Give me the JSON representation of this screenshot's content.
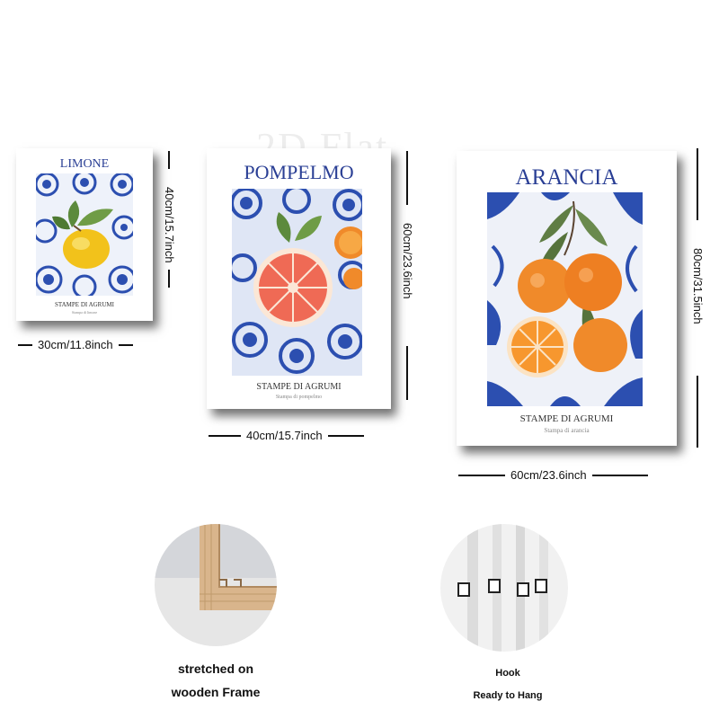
{
  "watermark": "2D Flat",
  "posters": [
    {
      "title": "LIMONE",
      "subtitle": "STAMPE DI AGRUMI",
      "fine_print": "Stampa di limone",
      "width_label": "30cm/11.8inch",
      "height_label": "40cm/15.7inch"
    },
    {
      "title": "POMPELMO",
      "subtitle": "STAMPE DI AGRUMI",
      "fine_print": "Stampa di pompelmo",
      "width_label": "40cm/15.7inch",
      "height_label": "60cm/23.6inch"
    },
    {
      "title": "ARANCIA",
      "subtitle": "STAMPE DI AGRUMI",
      "fine_print": "Stampa di arancia",
      "width_label": "60cm/23.6inch",
      "height_label": "80cm/31.5inch"
    }
  ],
  "features": [
    {
      "caption_line1": "stretched on",
      "caption_line2": "wooden Frame"
    },
    {
      "caption_line1": "Hook",
      "caption_line2": "Ready to Hang"
    }
  ],
  "colors": {
    "title_blue": "#2a3f95",
    "tile_blue": "#2c4fb0",
    "lemon": "#f2c21b",
    "grapefruit": "#ef6a55",
    "orange": "#f08a2a",
    "wood": "#d9b58c"
  }
}
